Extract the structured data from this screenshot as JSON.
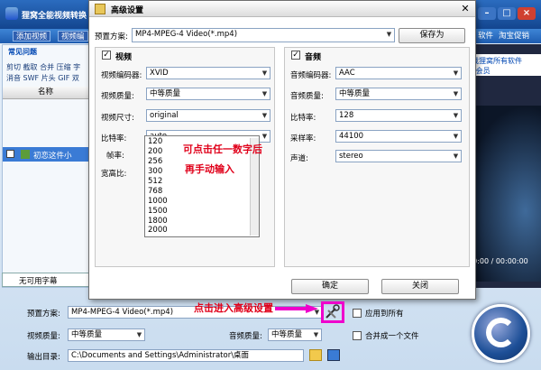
{
  "bg": {
    "title": "狸窝全能视频转换",
    "toolbar": {
      "add_video": "添加视频",
      "video_edit": "视频编",
      "right_item1": "软件",
      "right_item2": "淘宝促销"
    },
    "left": {
      "tab": "常见问题",
      "menu1": "剪切 截取 合并 压缩 字",
      "menu2": "消音 SWF 片头 GIF 双",
      "col_name": "名称",
      "file_name": "初恋这件小"
    },
    "right": {
      "link1": "下载狸窝所有软件",
      "link2": "VIP会员",
      "time": "00:00 / 00:00:00"
    },
    "subtitle": "无可用字幕",
    "bottom": {
      "preset_label": "预置方案:",
      "preset_value": "MP4-MPEG-4 Video(*.mp4)",
      "apply_all": "应用到所有",
      "vq_label": "视频质量:",
      "vq_value": "中等质量",
      "aq_label": "音频质量:",
      "aq_value": "中等质量",
      "merge": "合并成一个文件",
      "out_label": "输出目录:",
      "out_value": "C:\\Documents and Settings\\Administrator\\桌面"
    }
  },
  "dialog": {
    "title": "高级设置",
    "preset_label": "预置方案:",
    "preset_value": "MP4-MPEG-4 Video(*.mp4)",
    "save_as": "保存为",
    "video": {
      "title": "视频",
      "encoder_label": "视频编码器:",
      "encoder_value": "XVID",
      "quality_label": "视频质量:",
      "quality_value": "中等质量",
      "size_label": "视频尺寸:",
      "size_value": "original",
      "bitrate_label": "比特率:",
      "bitrate_value": "auto",
      "fps_label": "帧率:",
      "aspect_label": "宽高比:",
      "bitrate_options": [
        "120",
        "200",
        "256",
        "300",
        "512",
        "768",
        "1000",
        "1500",
        "1800",
        "2000"
      ]
    },
    "audio": {
      "title": "音频",
      "encoder_label": "音频编码器:",
      "encoder_value": "AAC",
      "quality_label": "音频质量:",
      "quality_value": "中等质量",
      "bitrate_label": "比特率:",
      "bitrate_value": "128",
      "sample_label": "采样率:",
      "sample_value": "44100",
      "channel_label": "声道:",
      "channel_value": "stereo"
    },
    "ok": "确定",
    "close": "关闭"
  },
  "annotations": {
    "note1": "可点击任一数字后",
    "note2": "再手动输入",
    "note3": "点击进入高级设置"
  }
}
